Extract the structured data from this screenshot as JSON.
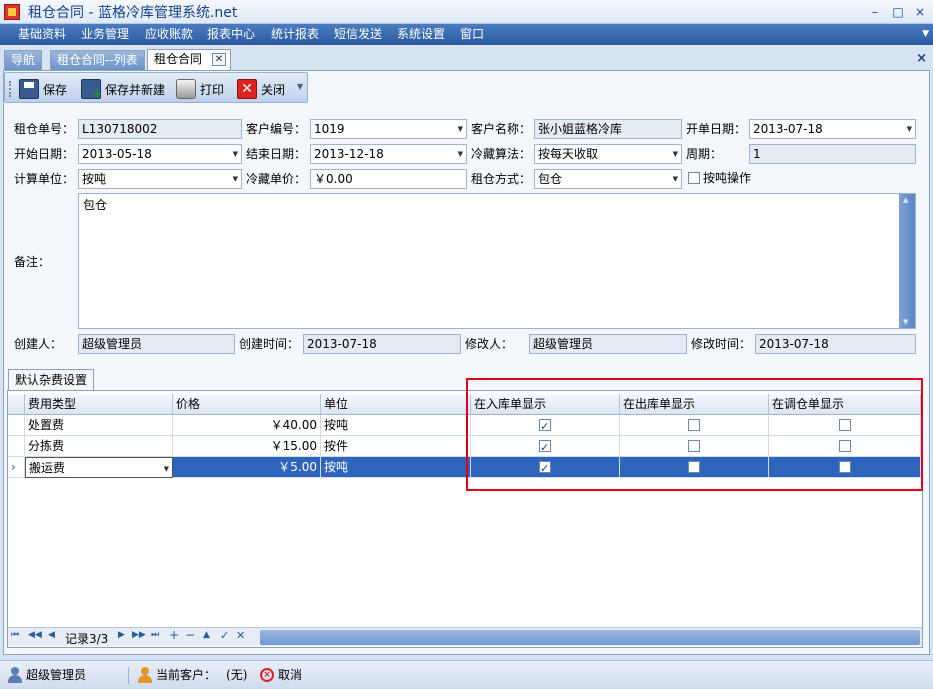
{
  "window": {
    "title": "租仓合同 - 蓝格冷库管理系统.net",
    "min": "–",
    "max": "□",
    "close": "×"
  },
  "menu": [
    "基础资料",
    "业务管理",
    "应收账款",
    "报表中心",
    "统计报表",
    "短信发送",
    "系统设置",
    "窗口"
  ],
  "tabs": [
    "导航",
    "租仓合同--列表",
    "租仓合同"
  ],
  "toolbar": {
    "save": "保存",
    "save_new": "保存并新建",
    "print": "打印",
    "close": "关闭"
  },
  "form": {
    "contract_no_label": "租仓单号：",
    "contract_no": "L130718002",
    "customer_code_label": "客户编号：",
    "customer_code": "1019",
    "customer_name_label": "客户名称：",
    "customer_name": "张小姐蓝格冷库",
    "open_date_label": "开单日期：",
    "open_date": "2013-07-18",
    "start_date_label": "开始日期：",
    "start_date": "2013-05-18",
    "end_date_label": "结束日期：",
    "end_date": "2013-12-18",
    "algo_label": "冷藏算法：",
    "algo": "按每天收取",
    "period_label": "周期：",
    "period": "1",
    "unit_label": "计算单位：",
    "unit": "按吨",
    "price_label": "冷藏单价：",
    "price": "￥0.00",
    "mode_label": "租仓方式：",
    "mode": "包仓",
    "by_ton_label": "按吨操作",
    "by_ton_checked": false,
    "remarks_label": "备注：",
    "remarks": "包仓",
    "creator_label": "创建人：",
    "creator": "超级管理员",
    "created_label": "创建时间：",
    "created": "2013-07-18",
    "modifier_label": "修改人：",
    "modifier": "超级管理员",
    "modified_label": "修改时间：",
    "modified": "2013-07-18"
  },
  "subtab": "默认杂费设置",
  "grid": {
    "columns": [
      "费用类型",
      "价格",
      "单位",
      "在入库单显示",
      "在出库单显示",
      "在调仓单显示"
    ],
    "rows": [
      {
        "type": "处置费",
        "price": "￥40.00",
        "unit": "按吨",
        "in": true,
        "out": false,
        "transfer": false
      },
      {
        "type": "分拣费",
        "price": "￥15.00",
        "unit": "按件",
        "in": true,
        "out": false,
        "transfer": false
      },
      {
        "type": "搬运费",
        "price": "￥5.00",
        "unit": "按吨",
        "in": true,
        "out": false,
        "transfer": false
      }
    ],
    "selected_row": 2,
    "row_indicator": "›"
  },
  "navigator": {
    "record": "记录3/3"
  },
  "status": {
    "user": "超级管理员",
    "current_customer_label": "当前客户：",
    "current_customer": "(无)",
    "cancel": "取消"
  }
}
